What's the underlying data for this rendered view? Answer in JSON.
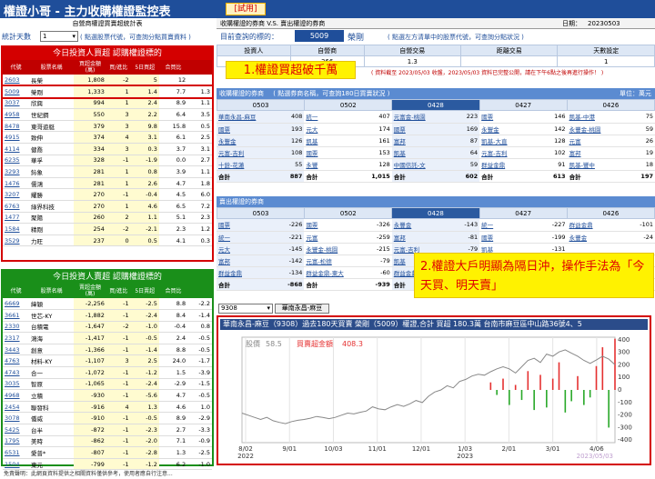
{
  "app": {
    "title": "權證小哥 - 主力收購權證監控表",
    "badge": "[試用]",
    "right_header": "收購權證的券商 V.S. 賣出權證的券商",
    "date_label": "日期：",
    "date": "20230503",
    "left_header": "自營商權證買賣超統計表"
  },
  "stats": {
    "label": "統計天數",
    "value": "1",
    "hint": "( 點選股票代號，可查詢分點買賣資料 )"
  },
  "buy_table": {
    "title": "今日投資人買超 認購權證標的",
    "headers": [
      "代號",
      "股票名稱",
      "買超金額(萬)",
      "買/進比",
      "5日買超",
      "合買比"
    ],
    "rows": [
      [
        "2603",
        "長榮",
        "1,808",
        "-2",
        "5",
        "12"
      ],
      [
        "5009",
        "榮剛",
        "1,333",
        "1",
        "1.4",
        "7.7",
        "1.3"
      ],
      [
        "3037",
        "欣興",
        "994",
        "1",
        "2.4",
        "8.9",
        "1.1"
      ],
      [
        "4958",
        "世紀鋼",
        "550",
        "3",
        "2.2",
        "6.4",
        "3.5"
      ],
      [
        "8478",
        "東哥遊艇",
        "379",
        "3",
        "9.8",
        "15.8",
        "0.5"
      ],
      [
        "4915",
        "致伸",
        "374",
        "4",
        "3.1",
        "6.1",
        "2.5"
      ],
      [
        "4114",
        "健喬",
        "334",
        "3",
        "0.3",
        "3.7",
        "3.1"
      ],
      [
        "6235",
        "華孚",
        "328",
        "-1",
        "-1.9",
        "0.0",
        "2.7"
      ],
      [
        "3293",
        "鈊象",
        "281",
        "1",
        "0.8",
        "3.9",
        "1.1"
      ],
      [
        "1476",
        "儒鴻",
        "281",
        "1",
        "2.6",
        "4.7",
        "1.8"
      ],
      [
        "3207",
        "耀勝",
        "270",
        "-1",
        "-0.4",
        "4.5",
        "6.0"
      ],
      [
        "6763",
        "綠界科技",
        "270",
        "1",
        "4.6",
        "6.5",
        "7.2"
      ],
      [
        "1477",
        "聚陽",
        "260",
        "2",
        "1.1",
        "5.1",
        "2.3"
      ],
      [
        "1584",
        "精剛",
        "254",
        "-2",
        "-2.1",
        "2.3",
        "1.2"
      ],
      [
        "3529",
        "力旺",
        "237",
        "0",
        "0.5",
        "4.1",
        "0.3"
      ]
    ]
  },
  "sell_table": {
    "title": "今日投資人賣超 認購權證標的",
    "headers": [
      "代號",
      "股票名稱",
      "賣超金額(萬)",
      "買/進比",
      "5日賣超",
      "合買比"
    ],
    "rows": [
      [
        "6669",
        "緯穎",
        "-2,256",
        "-1",
        "-2.5",
        "8.8",
        "-2.2"
      ],
      [
        "3661",
        "世芯-KY",
        "-1,882",
        "-1",
        "-2.4",
        "8.4",
        "-1.4"
      ],
      [
        "2330",
        "台積電",
        "-1,647",
        "-2",
        "-1.0",
        "-0.4",
        "0.8"
      ],
      [
        "2317",
        "鴻海",
        "-1,417",
        "-1",
        "-0.5",
        "2.4",
        "-0.5"
      ],
      [
        "3443",
        "創意",
        "-1,366",
        "-1",
        "-1.4",
        "8.8",
        "-0.5"
      ],
      [
        "4763",
        "材料-KY",
        "-1,107",
        "3",
        "2.5",
        "24.0",
        "-1.7"
      ],
      [
        "4743",
        "合一",
        "-1,072",
        "-1",
        "-1.2",
        "1.5",
        "-3.9"
      ],
      [
        "3035",
        "智原",
        "-1,065",
        "-1",
        "-2.4",
        "-2.9",
        "-1.5"
      ],
      [
        "4968",
        "立積",
        "-930",
        "-1",
        "-5.6",
        "4.7",
        "-0.5"
      ],
      [
        "2454",
        "聯發科",
        "-916",
        "4",
        "1.3",
        "4.6",
        "1.0"
      ],
      [
        "3078",
        "僑威",
        "-910",
        "-1",
        "-0.5",
        "8.9",
        "-2.9"
      ],
      [
        "5425",
        "台半",
        "-872",
        "-1",
        "-2.3",
        "2.7",
        "-3.3"
      ],
      [
        "1795",
        "美時",
        "-862",
        "-1",
        "-2.0",
        "7.1",
        "-0.9"
      ],
      [
        "6531",
        "愛普*",
        "-807",
        "-1",
        "-2.8",
        "1.3",
        "-2.5"
      ],
      [
        "1504",
        "東元",
        "-799",
        "-1",
        "-1.2",
        "6.2",
        "-1.0"
      ]
    ]
  },
  "query": {
    "label": "目前查詢的標的：",
    "code": "5009",
    "name": "榮剛",
    "hint": "( 點選左方清單中的股票代號，可查詢分點狀況 )"
  },
  "summary": {
    "headers": [
      "投資人",
      "自營商",
      "自營交易",
      "距離交易",
      "天數設定"
    ],
    "values": [
      "",
      "366",
      "1.3",
      "",
      "1"
    ],
    "notice": "( 資料截至 2023/05/03 收盤，2023/05/03 資料已完整公開，請在下午6點之後再進行操作！ )"
  },
  "overlay1": "1.權證買超破千萬",
  "overlay2": "2.權證大戶明顯為隔日沖，操作手法為「今天買、明天賣」",
  "buy_brokers": {
    "title": "收購權證的券商",
    "hint": "( 點選券商名稱，可查詢180日買賣狀況 )",
    "unit": "單位：萬元",
    "dates": [
      "0503",
      "0502",
      "0428",
      "0427",
      "0426"
    ],
    "rows": [
      [
        [
          "華南永昌-麻豆",
          "408"
        ],
        [
          "統一",
          "407"
        ],
        [
          "元富金-桃園",
          "223"
        ],
        [
          "國票",
          "146"
        ],
        [
          "凱基-中港",
          "75"
        ]
      ],
      [
        [
          "國票",
          "193"
        ],
        [
          "元大",
          "174"
        ],
        [
          "國票",
          "169"
        ],
        [
          "永豐金",
          "142"
        ],
        [
          "永豐金-桃園",
          "59"
        ]
      ],
      [
        [
          "永豐金",
          "126"
        ],
        [
          "凱基",
          "161"
        ],
        [
          "富邦",
          "87"
        ],
        [
          "凱基-大直",
          "128"
        ],
        [
          "元富",
          "26"
        ]
      ],
      [
        [
          "元富-吉利",
          "108"
        ],
        [
          "國票",
          "153"
        ],
        [
          "凱基",
          "64"
        ],
        [
          "元富-吉利",
          "102"
        ],
        [
          "富邦",
          "19"
        ]
      ],
      [
        [
          "十銓-花蓮",
          "55"
        ],
        [
          "永豐",
          "128"
        ],
        [
          "中國信託-文",
          "59"
        ],
        [
          "群益金鼎",
          "91"
        ],
        [
          "凱基-豐中",
          "18"
        ]
      ]
    ],
    "sum_label": "合計",
    "sums": [
      "887",
      "1,015",
      "602",
      "613",
      "197"
    ]
  },
  "sell_brokers": {
    "title": "賣出權證的券商",
    "dates": [
      "0503",
      "0502",
      "0428",
      "0427",
      "0426"
    ],
    "rows": [
      [
        [
          "國票",
          "-226"
        ],
        [
          "國票",
          "-326"
        ],
        [
          "永豐金",
          "-143"
        ],
        [
          "統一",
          "-227"
        ],
        [
          "群益金鼎",
          "-101"
        ]
      ],
      [
        [
          "統一",
          "-221"
        ],
        [
          "元富",
          "-259"
        ],
        [
          "富邦",
          "-81"
        ],
        [
          "國票",
          "-199"
        ],
        [
          "永豐金",
          "-24"
        ]
      ],
      [
        [
          "元大",
          "-145"
        ],
        [
          "永豐金-桃園",
          "-215"
        ],
        [
          "元富-吉利",
          "-79"
        ],
        [
          "凱基",
          "-131"
        ],
        [
          "",
          ""
        ]
      ],
      [
        [
          "富邦",
          "-142"
        ],
        [
          "元富-松德",
          "-79"
        ],
        [
          "凱基",
          "-55"
        ],
        [
          "",
          ""
        ],
        [
          "",
          ""
        ]
      ],
      [
        [
          "群益金鼎",
          "-134"
        ],
        [
          "群益金鼎-東大",
          "-60"
        ],
        [
          "群益金鼎",
          "-64"
        ],
        [
          "",
          ""
        ],
        [
          "",
          ""
        ]
      ]
    ],
    "sum_label": "合計",
    "sums": [
      "-868",
      "-939",
      "",
      "",
      ""
    ]
  },
  "broker_select": {
    "value": "9308",
    "button": "華南永昌-麻豆"
  },
  "chart_data": {
    "type": "line",
    "title": "華南永昌-麻豆（9308）過去180天買賣 榮剛（5009）權證,合計 買超 180.3萬 台南市麻豆區中山路36號4、5",
    "legend": [
      {
        "name": "股價",
        "value": "58.5"
      },
      {
        "name": "買賣超金額",
        "value": "408.3"
      }
    ],
    "x": [
      "8/02",
      "9/01",
      "10/03",
      "11/01",
      "12/01",
      "1/03",
      "2/01",
      "3/01",
      "4/06"
    ],
    "year_labels": [
      "2022",
      "",
      "",
      "",
      "",
      "2023",
      "",
      "",
      ""
    ],
    "date_end": "2023/05/03",
    "price": [
      47,
      46.5,
      46,
      45.5,
      46,
      45.2,
      44.8,
      44.5,
      45,
      45.3,
      45.5,
      45.8,
      46.2,
      46,
      45.7,
      46,
      46.5,
      47,
      46.8,
      47.2,
      47.5,
      48.5,
      48,
      47.8,
      48.5,
      49,
      48.6,
      49.2,
      50,
      49.5,
      51,
      52,
      52.5,
      53.5,
      53,
      54.5,
      55,
      55.8,
      56.2,
      56,
      56.8,
      57.5,
      58,
      57.5,
      56.5,
      58,
      59.5,
      60,
      59,
      61,
      60.5,
      61.5,
      62,
      61.2,
      60.5,
      59.5,
      58.8,
      59.6,
      60.5,
      59.8,
      58.5
    ],
    "y_right": [
      400,
      300,
      200,
      100,
      0,
      -100,
      -200,
      -300,
      -400
    ],
    "ylim_price": [
      40,
      65
    ],
    "ylim_flow": [
      -420,
      420
    ],
    "flows": [
      {
        "i": 40,
        "v": 60
      },
      {
        "i": 41,
        "v": -40
      },
      {
        "i": 42,
        "v": 90
      },
      {
        "i": 43,
        "v": -120
      },
      {
        "i": 44,
        "v": 40
      },
      {
        "i": 45,
        "v": -80
      },
      {
        "i": 46,
        "v": 150
      },
      {
        "i": 47,
        "v": -160
      },
      {
        "i": 48,
        "v": 120
      },
      {
        "i": 49,
        "v": -140
      },
      {
        "i": 50,
        "v": 90
      },
      {
        "i": 51,
        "v": 220
      },
      {
        "i": 52,
        "v": -180
      },
      {
        "i": 53,
        "v": -90
      },
      {
        "i": 54,
        "v": 110
      },
      {
        "i": 55,
        "v": -120
      },
      {
        "i": 56,
        "v": -60
      },
      {
        "i": 57,
        "v": 190
      },
      {
        "i": 58,
        "v": 340
      },
      {
        "i": 59,
        "v": -300
      },
      {
        "i": 60,
        "v": 408
      }
    ]
  },
  "footer": "免責聲明：此網頁資料提供之相關資料僅供參考，使用者應自行注意..."
}
